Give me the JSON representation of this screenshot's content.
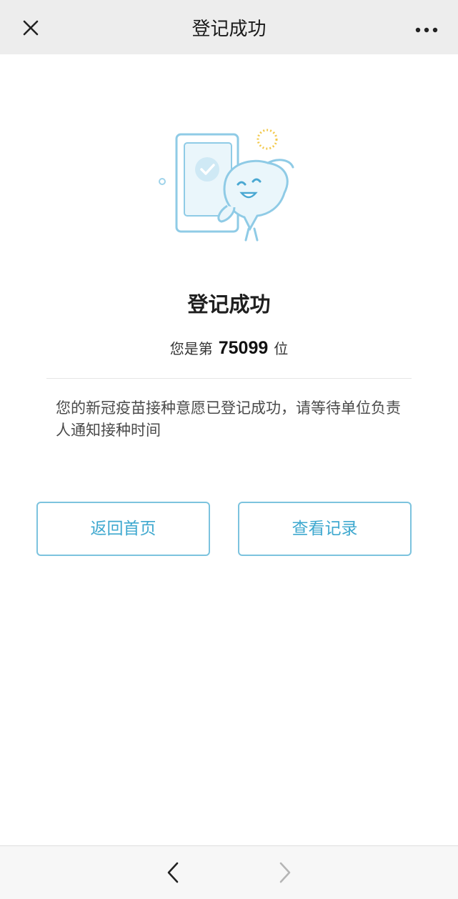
{
  "header": {
    "title": "登记成功",
    "close_icon": "close-icon",
    "more_icon": "more-icon"
  },
  "main": {
    "illustration_icon": "success-mascot-illustration",
    "success_title": "登记成功",
    "queue_prefix": "您是第",
    "queue_number": "75099",
    "queue_suffix": "位",
    "message": "您的新冠疫苗接种意愿已登记成功，请等待单位负责人通知接种时间"
  },
  "actions": {
    "home_label": "返回首页",
    "records_label": "查看记录"
  },
  "bottom_nav": {
    "back_icon": "chevron-left-icon",
    "forward_icon": "chevron-right-icon"
  },
  "colors": {
    "accent": "#3ea8cf",
    "border": "#7cc3de",
    "topbar_bg": "#ededed"
  }
}
